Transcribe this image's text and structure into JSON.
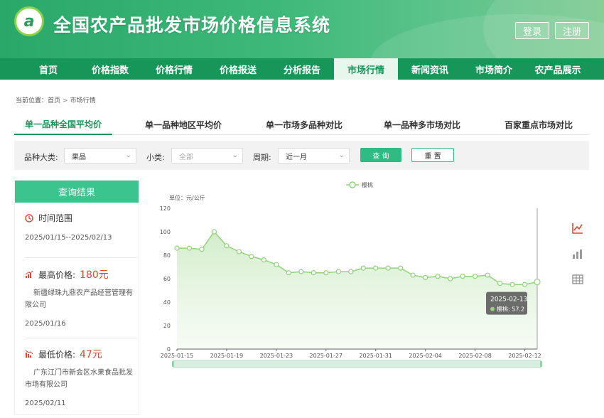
{
  "header": {
    "logo_text": "a",
    "title": "全国农产品批发市场价格信息系统",
    "login": "登录",
    "register": "注册"
  },
  "nav": {
    "items": [
      "首页",
      "价格指数",
      "价格行情",
      "价格报送",
      "分析报告",
      "市场行情",
      "新闻资讯",
      "市场简介",
      "农产品展示"
    ],
    "active_index": 5
  },
  "breadcrumb": {
    "prefix": "当前位置：",
    "home": "首页",
    "current": "市场行情"
  },
  "tabs": {
    "items": [
      "单一品种全国平均价",
      "单一品种地区平均价",
      "单一市场多品种对比",
      "单一品种多市场对比",
      "百家重点市场对比"
    ],
    "active_index": 0
  },
  "filter": {
    "category_label": "品种大类:",
    "category_value": "果品",
    "subcategory_label": "小类:",
    "subcategory_placeholder": "全部",
    "period_label": "周期:",
    "period_value": "近一月",
    "query_button": "查 询",
    "reset_button": "重 置"
  },
  "results": {
    "title": "查询结果",
    "range_label": "时间范围",
    "range_value": "2025/01/15--2025/02/13",
    "max_label": "最高价格:",
    "max_price": "180元",
    "max_market": "新疆绿珠九鼎农产品经营管理有限公司",
    "max_date": "2025/01/16",
    "min_label": "最低价格:",
    "min_price": "47元",
    "min_market": "广东江门市新会区水果食品批发市场有限公司",
    "min_date": "2025/02/11"
  },
  "colors": {
    "brand": "#17965a",
    "accent": "#3cc48f",
    "line": "#8fd47a",
    "price_red": "#d84a2b"
  },
  "icons": {
    "range": "clock-icon",
    "max": "trend-up-icon",
    "min": "trend-down-icon",
    "line_chart": "line-chart-icon",
    "bar_chart": "bar-chart-icon",
    "table": "table-icon"
  },
  "chart_data": {
    "type": "area",
    "unit_label": "单位：元/公斤",
    "series": [
      {
        "name": "樱桃",
        "x": [
          "2025-01-15",
          "2025-01-16",
          "2025-01-17",
          "2025-01-18",
          "2025-01-19",
          "2025-01-20",
          "2025-01-21",
          "2025-01-22",
          "2025-01-23",
          "2025-01-24",
          "2025-01-25",
          "2025-01-26",
          "2025-01-27",
          "2025-01-28",
          "2025-01-29",
          "2025-01-30",
          "2025-01-31",
          "2025-02-01",
          "2025-02-02",
          "2025-02-03",
          "2025-02-04",
          "2025-02-05",
          "2025-02-06",
          "2025-02-07",
          "2025-02-08",
          "2025-02-09",
          "2025-02-10",
          "2025-02-11",
          "2025-02-12",
          "2025-02-13"
        ],
        "values": [
          86,
          86,
          85,
          100,
          88,
          83,
          79,
          76,
          72,
          65,
          66,
          65,
          65,
          66,
          66,
          69,
          69,
          69,
          69,
          63,
          61,
          62,
          60,
          62,
          62,
          63,
          56,
          55,
          55,
          57.2
        ]
      }
    ],
    "x_ticks": [
      "2025-01-15",
      "2025-01-19",
      "2025-01-23",
      "2025-01-27",
      "2025-01-31",
      "2025-02-04",
      "2025-02-08",
      "2025-02-12"
    ],
    "ylim": [
      0,
      120
    ],
    "y_ticks": [
      0,
      20,
      40,
      60,
      80,
      100,
      120
    ],
    "legend": "top-center",
    "grid": false,
    "tooltip": {
      "date": "2025-02-13",
      "label": "樱桃: 57.2"
    }
  }
}
